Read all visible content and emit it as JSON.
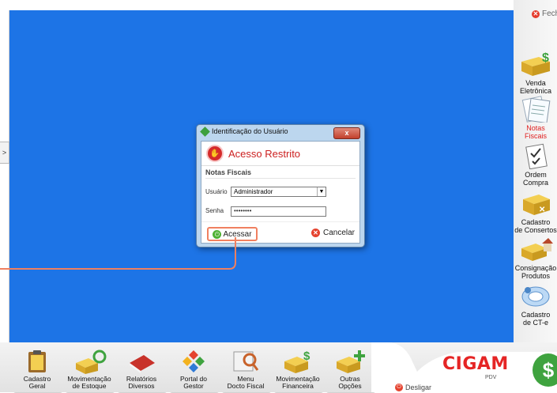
{
  "header": {
    "close_label": "Fecha"
  },
  "sidebar": {
    "toggle_label": ">",
    "items": [
      {
        "label": "Venda\nEletrônica",
        "icon": "dollar-box-icon"
      },
      {
        "label": "Notas\nFiscais",
        "icon": "invoice-icon",
        "active": true
      },
      {
        "label": "Ordem\nCompra",
        "icon": "checklist-icon"
      },
      {
        "label": "Cadastro\nde Consertos",
        "icon": "repair-box-icon"
      },
      {
        "label": "Consignação\nProdutos",
        "icon": "house-box-icon"
      },
      {
        "label": "Cadastro\nde CT-e",
        "icon": "blue-document-icon"
      }
    ]
  },
  "dialog": {
    "window_title": "Identificação do Usuário",
    "close_symbol": "x",
    "heading": "Acesso Restrito",
    "section": "Notas Fiscais",
    "user_label": "Usuário",
    "user_value": "Administrador",
    "password_label": "Senha",
    "password_mask": "••••••••",
    "submit_label": "Acessar",
    "cancel_label": "Cancelar"
  },
  "bottom_bar": {
    "items": [
      {
        "label": "Cadastro\nGeral",
        "icon": "clipboard-icon"
      },
      {
        "label": "Movimentação\nde Estoque",
        "icon": "stock-refresh-icon"
      },
      {
        "label": "Relatórios\nDiversos",
        "icon": "red-book-icon"
      },
      {
        "label": "Portal do\nGestor",
        "icon": "diamond-icon"
      },
      {
        "label": "Menu\nDocto Fiscal",
        "icon": "nfe-search-icon"
      },
      {
        "label": "Movimentação\nFinanceira",
        "icon": "money-box-icon"
      },
      {
        "label": "Outras\nOpções",
        "icon": "plus-box-icon"
      }
    ],
    "shutdown_label": "Desligar"
  },
  "brand": {
    "name": "CIGAM",
    "sub": "PDV"
  },
  "colors": {
    "workspace": "#1d74e6",
    "accent_red": "#e52525",
    "callout": "#f08060"
  }
}
